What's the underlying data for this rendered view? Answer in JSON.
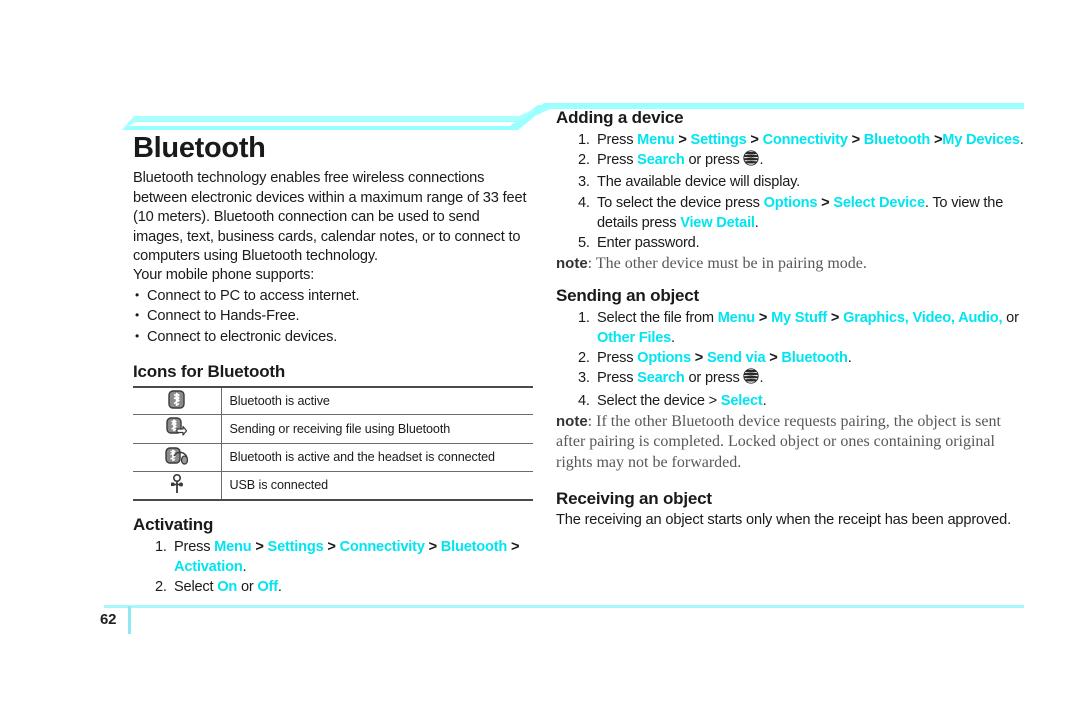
{
  "document": {
    "chapter_title": "Bluetooth",
    "page_number": "62",
    "accent_color": "#99ffff",
    "link_color": "#00e5f0"
  },
  "left_column": {
    "intro_paragraph": "Bluetooth technology enables free wireless connections between electronic devices within a maximum range of 33 feet (10 meters). Bluetooth connection can be used to send images, text, business cards, calendar notes, or to connect to computers using Bluetooth technology.",
    "supports_lead": "Your mobile phone supports:",
    "supports_items": [
      "Connect to PC to access internet.",
      "Connect to Hands-Free.",
      "Connect to electronic devices."
    ],
    "icons_heading": "Icons for Bluetooth",
    "icon_table": [
      {
        "icon": "bluetooth-active-icon",
        "description": "Bluetooth is active"
      },
      {
        "icon": "bluetooth-transfer-icon",
        "description": "Sending  or receiving file using Bluetooth"
      },
      {
        "icon": "bluetooth-headset-icon",
        "description": "Bluetooth is active and the headset is connected"
      },
      {
        "icon": "usb-connected-icon",
        "description": "USB is connected"
      }
    ],
    "activating": {
      "heading": "Activating",
      "step1": {
        "lead": "Press ",
        "menu": "Menu",
        "settings": "Settings",
        "connectivity": "Connectivity",
        "bluetooth": "Bluetooth",
        "activation": "Activation",
        "period": "."
      },
      "step2": {
        "lead": "Select ",
        "on": "On",
        "or": " or ",
        "off": "Off",
        "period": "."
      }
    }
  },
  "right_column": {
    "adding_device": {
      "heading": "Adding a device",
      "step1": {
        "lead": "Press ",
        "menu": "Menu",
        "settings": "Settings",
        "connectivity": "Connectivity",
        "bluetooth": "Bluetooth",
        "my_devices": "My Devices",
        "period": "."
      },
      "step2": {
        "lead": "Press ",
        "search": "Search",
        "mid": " or press ",
        "icon": "att-globe-icon",
        "period": "."
      },
      "step3": "The available device will display.",
      "step4": {
        "lead": "To select the device press ",
        "options": "Options",
        "select_device": "Select Device",
        "mid": ". To view the details press ",
        "view_detail": "View Detail",
        "period": "."
      },
      "step5": "Enter password.",
      "note_label": "note",
      "note_text": ": The other device must be in pairing mode."
    },
    "sending_object": {
      "heading": "Sending an object",
      "step1": {
        "lead": "Select the file from ",
        "menu": "Menu",
        "my_stuff": "My Stuff",
        "graphics_video_audio": "Graphics, Video, Audio,",
        "or": " or ",
        "other_files": "Other Files",
        "period": "."
      },
      "step2": {
        "lead": "Press ",
        "options": "Options",
        "send_via": "Send via",
        "bluetooth": "Bluetooth",
        "period": "."
      },
      "step3": {
        "lead": "Press ",
        "search": "Search",
        "mid": " or press ",
        "icon": "att-globe-icon",
        "period": "."
      },
      "step4": {
        "lead": "Select the device > ",
        "select": "Select",
        "period": "."
      },
      "note_label": "note",
      "note_text": ": If the other Bluetooth device requests pairing, the object is sent after pairing is completed. Locked object or ones containing original rights may not be forwarded."
    },
    "receiving_object": {
      "heading": "Receiving an object",
      "body": "The receiving an object starts only when the receipt has been approved."
    }
  }
}
